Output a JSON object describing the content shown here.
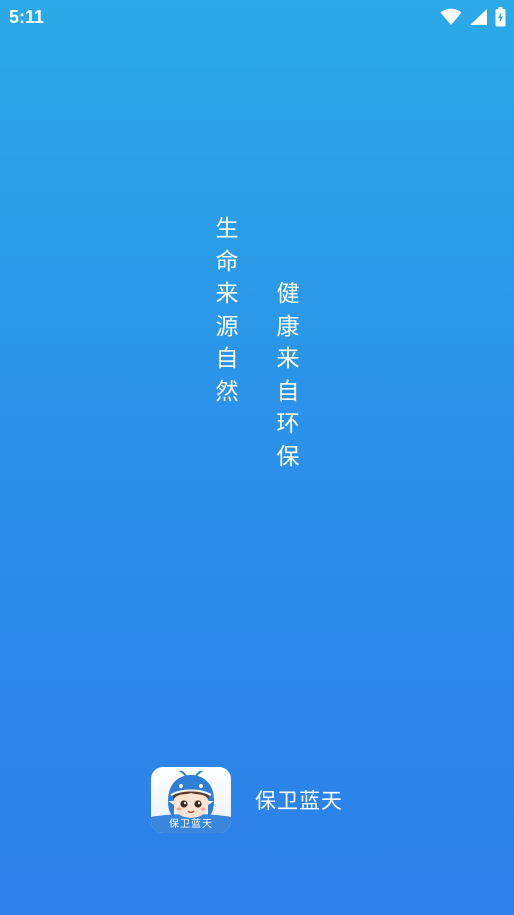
{
  "status_bar": {
    "time": "5:11",
    "icons": [
      "wifi-icon",
      "cellular-signal-icon",
      "battery-charging-icon"
    ]
  },
  "slogan": {
    "left_column": [
      "生",
      "命",
      "来",
      "源",
      "自",
      "然"
    ],
    "right_column": [
      "健",
      "康",
      "来",
      "自",
      "环",
      "保"
    ]
  },
  "brand": {
    "icon_caption": "保卫蓝天",
    "name": "保卫蓝天"
  },
  "colors": {
    "background_top": "#2ba9e8",
    "background_bottom": "#2d7fe9",
    "text": "#ffffff",
    "icon_mascot_blue": "#2f7fd6"
  }
}
